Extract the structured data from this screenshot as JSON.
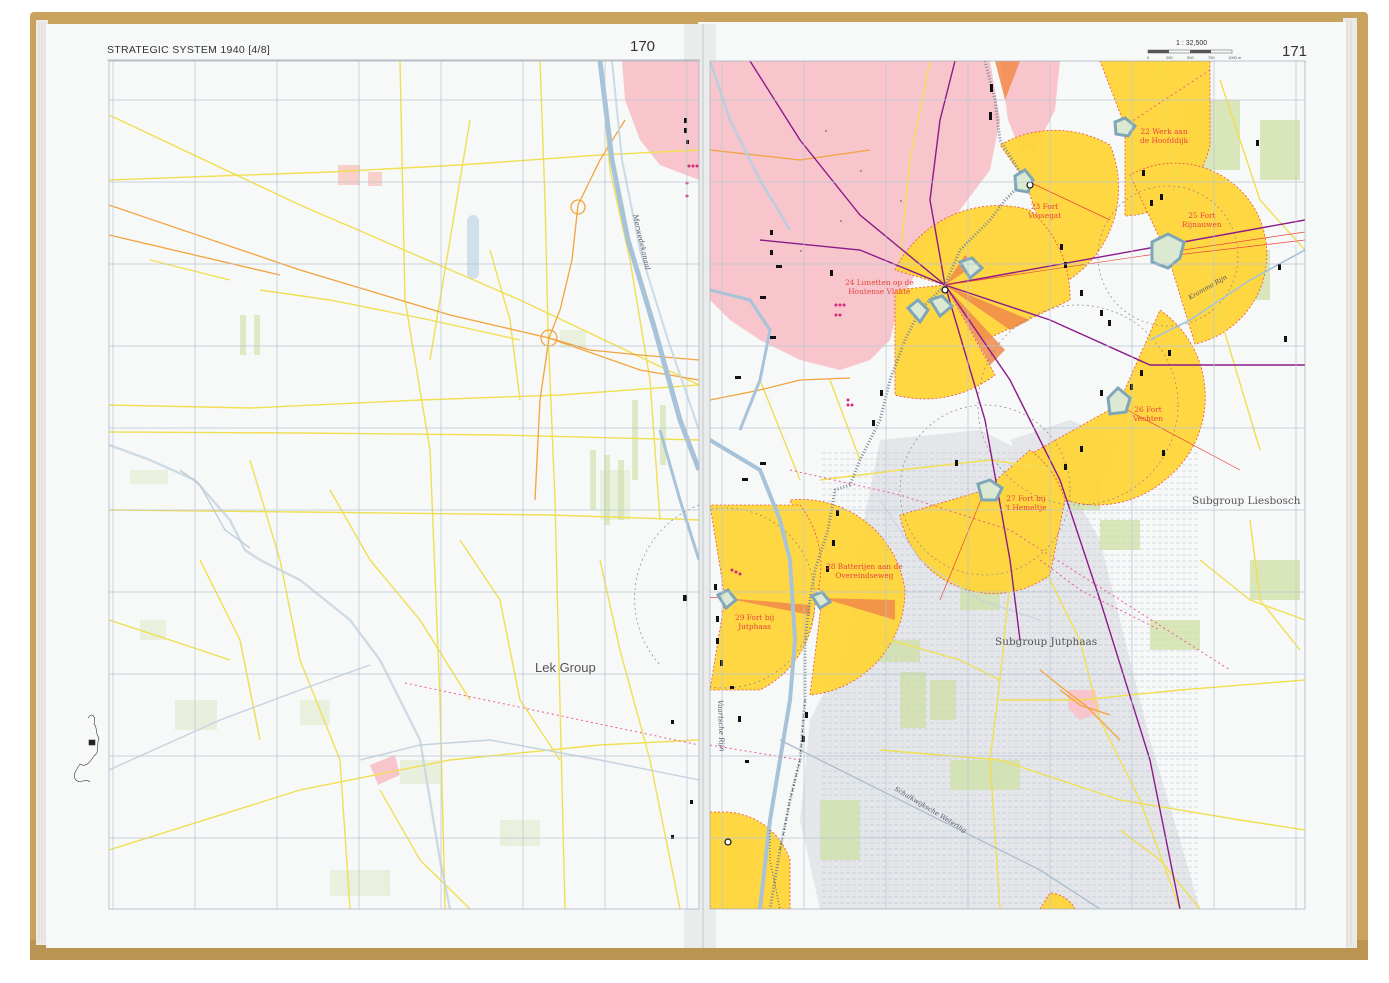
{
  "header": {
    "running_head": "STRATEGIC SYSTEM 1940  [4/8]",
    "page_left": "170",
    "page_right": "171",
    "scale": {
      "ratio": "1 : 32,500",
      "ticks": [
        "0",
        "250",
        "500",
        "750",
        "1000 m"
      ]
    }
  },
  "map": {
    "group_label": "Lek Group",
    "subgroups": [
      "Subgroup Liesbosch",
      "Subgroup Jutphaas"
    ],
    "waterways": [
      "Merwedekanaal",
      "Vaartsche Rijn",
      "Kromme Rijn",
      "Schalkwijksche Wetering"
    ],
    "forts": [
      {
        "number": "22",
        "name_line1": "Werk aan",
        "name_line2": "de Hoofddijk"
      },
      {
        "number": "23",
        "name_line1": "Fort",
        "name_line2": "Vossegat"
      },
      {
        "number": "24",
        "name_line1": "Lunetten op de",
        "name_line2": "Houtense Vlakte"
      },
      {
        "number": "25",
        "name_line1": "Fort",
        "name_line2": "Rijnauwen"
      },
      {
        "number": "26",
        "name_line1": "Fort",
        "name_line2": "Vechten"
      },
      {
        "number": "27",
        "name_line1": "Fort bij",
        "name_line2": "'t Hemeltje"
      },
      {
        "number": "28",
        "name_line1": "Batterijen aan de",
        "name_line2": "Overeindseweg"
      },
      {
        "number": "29",
        "name_line1": "Fort bij",
        "name_line2": "Jutphaas"
      }
    ]
  },
  "colors": {
    "cover": "#c9a25e",
    "page": "#f7f8f8",
    "grid": "#b8c6d2",
    "field_of_fire": "#ffd63a",
    "field_edge": "#e8453d",
    "urban": "#f7c5cb",
    "road_yellow": "#f1df52",
    "road_orange": "#f2a43d",
    "canal": "#a6c3da",
    "railway": "#8c1a8a"
  }
}
